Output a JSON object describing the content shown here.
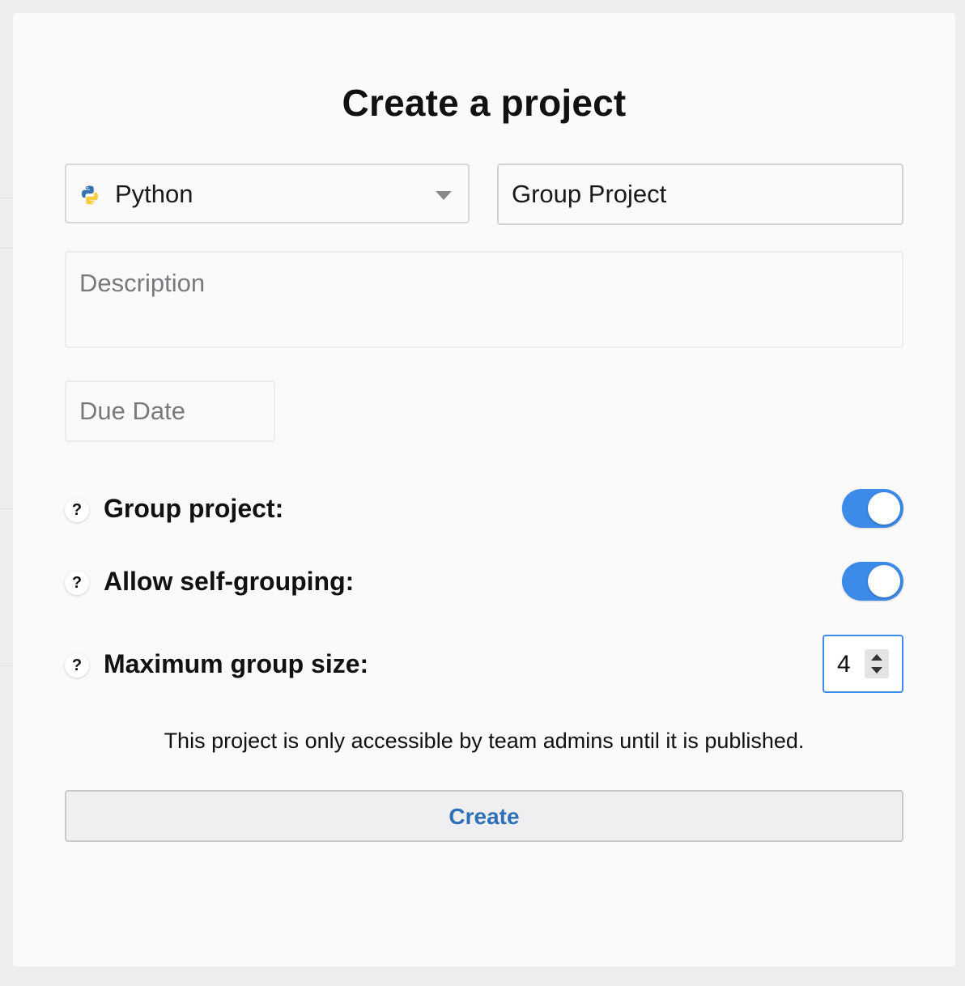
{
  "modal": {
    "title": "Create a project"
  },
  "form": {
    "language": {
      "selected": "Python",
      "icon": "python-icon"
    },
    "name": {
      "value": "Group Project"
    },
    "description": {
      "placeholder": "Description"
    },
    "due_date": {
      "placeholder": "Due Date"
    },
    "options": [
      {
        "label": "Group project:",
        "help": "?",
        "type": "toggle",
        "on": true
      },
      {
        "label": "Allow self-grouping:",
        "help": "?",
        "type": "toggle",
        "on": true
      },
      {
        "label": "Maximum group size:",
        "help": "?",
        "type": "number",
        "value": "4"
      }
    ],
    "notice": "This project is only accessible by team admins until it is published.",
    "submit_label": "Create"
  },
  "colors": {
    "accent": "#3d8be8",
    "button_text": "#2d6fb8",
    "background": "#fafafa"
  }
}
